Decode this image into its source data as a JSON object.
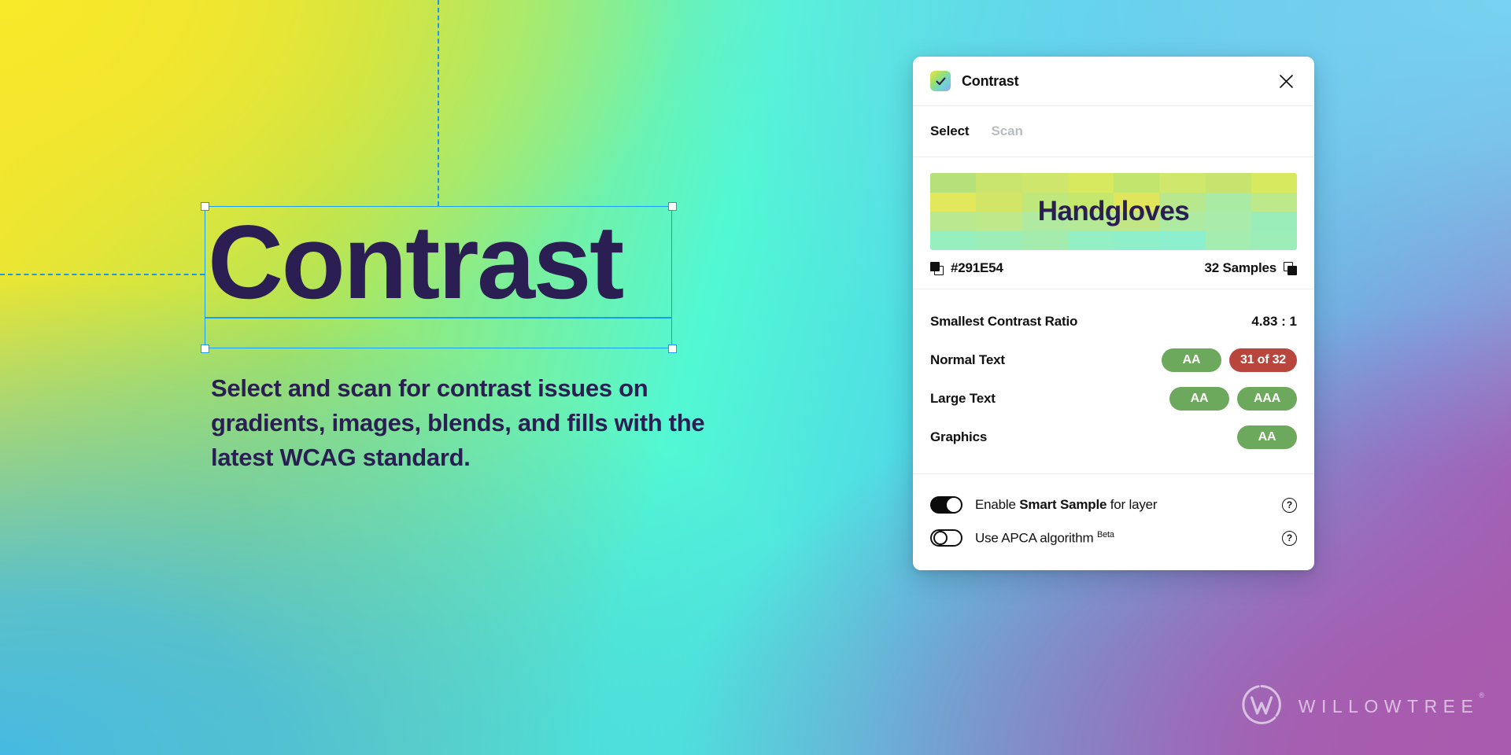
{
  "canvas": {
    "hero_title": "Contrast",
    "hero_subtitle": "Select and scan for contrast issues on gradients, images, blends, and fills with the latest WCAG standard.",
    "text_color": "#2A1E52",
    "selection_color": "#1A9CF0",
    "gradient_stops": [
      "#F2E62C",
      "#A9E45C",
      "#52F8D4",
      "#4FD7E8",
      "#5BB8E4",
      "#8A7ED0",
      "#A85BAE"
    ]
  },
  "panel": {
    "title": "Contrast",
    "icon": "gradient-check-icon",
    "close_icon": "close-icon",
    "tabs": [
      {
        "label": "Select",
        "active": true
      },
      {
        "label": "Scan",
        "active": false
      }
    ],
    "sample": {
      "preview_text": "Handgloves",
      "preview_text_color": "#2A1E52",
      "hex_label": "#291E54",
      "hex_copy_icon": "copy-icon",
      "samples_label": "32 Samples",
      "samples_copy_icon": "copy-icon",
      "tiles": [
        "#B5E07A",
        "#C9E56E",
        "#CDE66B",
        "#D7E95F",
        "#C2E56E",
        "#CFE76A",
        "#C7E46E",
        "#D6E95F",
        "#E2E85A",
        "#D2E566",
        "#BEE77C",
        "#C6E76E",
        "#E0E55C",
        "#B8E88D",
        "#A9EBA5",
        "#BEE98B",
        "#B9E890",
        "#BEE98A",
        "#AFEAA0",
        "#B6E996",
        "#C0E685",
        "#AEEAA2",
        "#A8EBAA",
        "#9AECB9",
        "#97EEBE",
        "#9DEDB6",
        "#A4ECAE",
        "#93EFC4",
        "#8FEFC9",
        "#8CEFCD",
        "#A4EDB0",
        "#9DEDB8"
      ]
    },
    "results": [
      {
        "label": "Smallest Contrast Ratio",
        "value": "4.83 : 1",
        "badges": []
      },
      {
        "label": "Normal Text",
        "badges": [
          {
            "text": "AA",
            "state": "pass"
          },
          {
            "text": "31 of 32",
            "state": "fail"
          }
        ]
      },
      {
        "label": "Large Text",
        "badges": [
          {
            "text": "AA",
            "state": "pass"
          },
          {
            "text": "AAA",
            "state": "pass"
          }
        ]
      },
      {
        "label": "Graphics",
        "badges": [
          {
            "text": "AA",
            "state": "pass"
          }
        ]
      }
    ],
    "badge_colors": {
      "pass": "#6DA95C",
      "fail": "#B8463C"
    },
    "options": [
      {
        "prefix": "Enable ",
        "strong": "Smart Sample",
        "suffix": " for layer",
        "sup": "",
        "on": true,
        "help_icon": "help-circle-icon"
      },
      {
        "prefix": "Use APCA algorithm ",
        "strong": "",
        "suffix": "",
        "sup": "Beta",
        "on": false,
        "help_icon": "help-circle-icon"
      }
    ]
  },
  "branding": {
    "wordmark": "WILLOWTREE",
    "trademark": "®",
    "logo_icon": "willowtree-w-logo"
  }
}
